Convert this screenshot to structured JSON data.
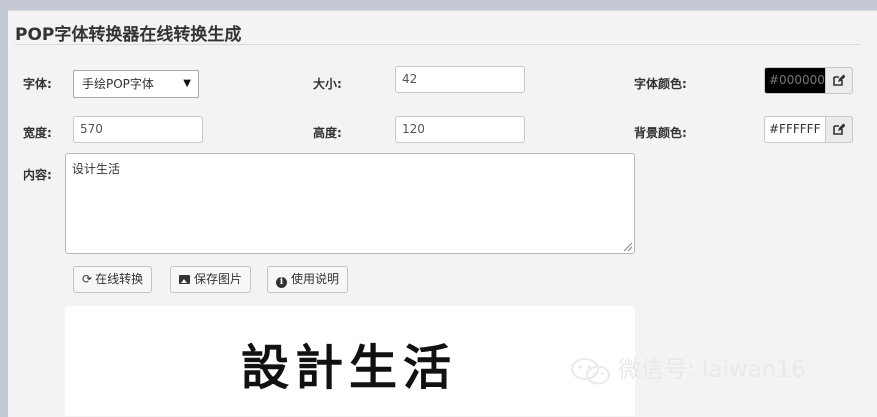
{
  "title": "POP字体转换器在线转换生成",
  "font": {
    "label": "字体:",
    "selected": "手绘POP字体",
    "arrow": "▼"
  },
  "size": {
    "label": "大小:",
    "value": "42"
  },
  "font_color": {
    "label": "字体颜色:",
    "value": "#000000",
    "swatch": "#000000"
  },
  "width": {
    "label": "宽度:",
    "value": "570"
  },
  "height": {
    "label": "高度:",
    "value": "120"
  },
  "bg_color": {
    "label": "背景颜色:",
    "value": "#FFFFFF",
    "swatch": "#FFFFFF"
  },
  "content": {
    "label": "内容:",
    "value": "设计生活"
  },
  "buttons": {
    "convert": {
      "label": "在线转换",
      "icon": "refresh-icon"
    },
    "save": {
      "label": "保存图片",
      "icon": "picture-icon"
    },
    "help": {
      "label": "使用说明",
      "icon": "info-icon"
    }
  },
  "preview": {
    "text": "設計生活"
  },
  "watermark": {
    "text": "微信号: laiwan16",
    "icon": "wechat-icon"
  },
  "colors": {
    "accent": "#333333",
    "page_bg": "#f3f3f3",
    "top_bar": "#c5c9d6"
  }
}
